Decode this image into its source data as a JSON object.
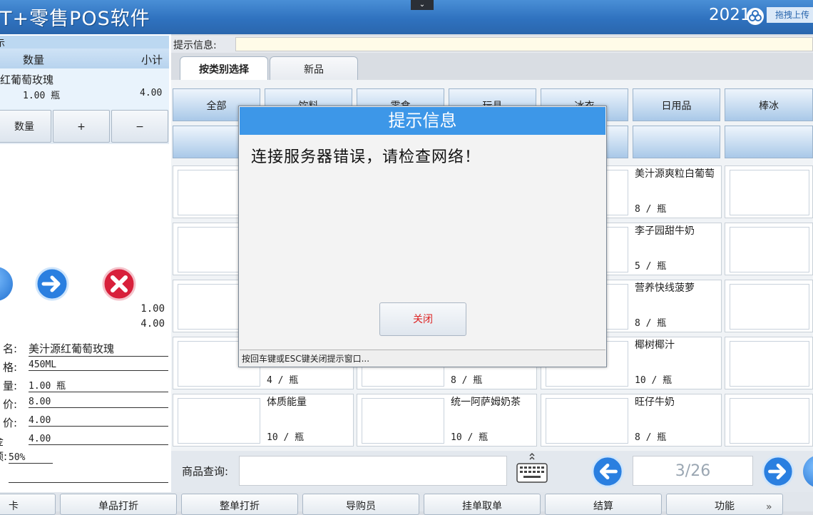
{
  "window": {
    "title": "T+零售POS软件",
    "year_text": "2021",
    "upload_label": "拖拽上传",
    "collapse_glyph": "⌄"
  },
  "cart": {
    "header_partial": "示",
    "col_qty": "数量",
    "col_subtotal": "小计",
    "item_name": "红葡萄玫瑰",
    "item_qty": "1.00 瓶",
    "item_subtotal": "4.00",
    "btn_qty": "数量",
    "btn_plus": "+",
    "btn_minus": "−"
  },
  "totals": {
    "qty": "1.00",
    "amount": "4.00"
  },
  "detail": [
    {
      "label": "名:",
      "value": "美汁源红葡萄玫瑰"
    },
    {
      "label": "格:",
      "value": "450ML"
    },
    {
      "label": "量:",
      "value": "1.00 瓶"
    },
    {
      "label": "价:",
      "value": "8.00"
    },
    {
      "label": "价:",
      "value": "4.00"
    },
    {
      "label": "金额:",
      "value": "4.00"
    }
  ],
  "discount": "50%",
  "hint": {
    "label": "提示信息:"
  },
  "tabs": [
    {
      "label": "按类别选择",
      "active": true
    },
    {
      "label": "新品",
      "active": false
    }
  ],
  "categories_row1": [
    "全部",
    "饮料",
    "零食",
    "玩具",
    "冰衣",
    "日用品",
    "棒冰"
  ],
  "products": {
    "col1": [
      {
        "name": "",
        "qty": ""
      },
      {
        "name": "",
        "qty": ""
      },
      {
        "name": "",
        "qty": ""
      },
      {
        "name": "",
        "qty": "4 / 瓶"
      },
      {
        "name": "体质能量",
        "qty": "10 / 瓶"
      }
    ],
    "col2": [
      {
        "name": "",
        "qty": "8 / 瓶"
      },
      {
        "name": "统一阿萨姆奶茶",
        "qty": "10 / 瓶"
      }
    ],
    "col3": [
      {
        "name": "美汁源爽粒白葡萄",
        "qty": "8 / 瓶"
      },
      {
        "name": "李子园甜牛奶",
        "qty": "5 / 瓶"
      },
      {
        "name": "营养快线菠萝",
        "qty": "8 / 瓶"
      },
      {
        "name": "椰树椰汁",
        "qty": "10 / 瓶"
      },
      {
        "name": "旺仔牛奶",
        "qty": "8 / 瓶"
      }
    ]
  },
  "search": {
    "label": "商品查询:",
    "value": ""
  },
  "pager": {
    "text": "3/26"
  },
  "function_buttons": [
    "卡",
    "单品打折",
    "整单打折",
    "导购员",
    "挂单取单",
    "结算",
    "功能"
  ],
  "dialog": {
    "title": "提示信息",
    "message": "连接服务器错误，请检查网络！",
    "close_label": "关闭",
    "status": "按回车键或ESC键关闭提示窗口..."
  },
  "colors": {
    "titlebar": "#2f72bf",
    "dialog_title": "#3d97e8",
    "close_text": "#dd2222"
  }
}
